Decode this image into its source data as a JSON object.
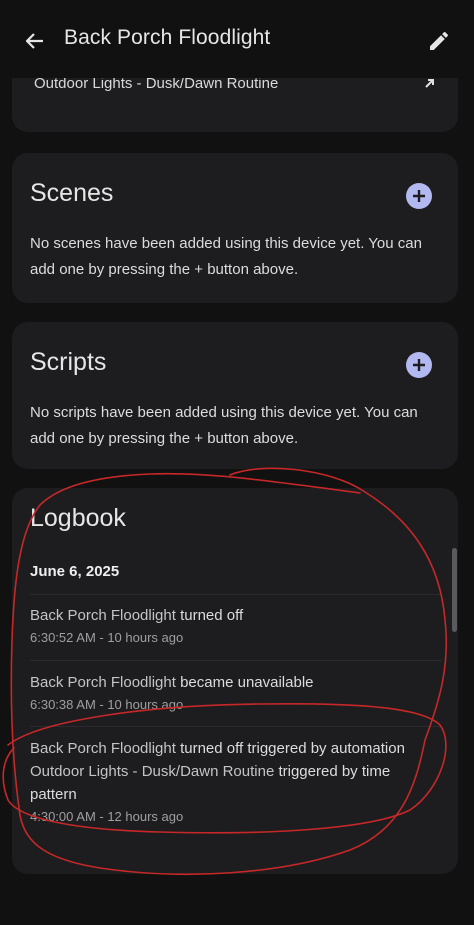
{
  "header": {
    "title": "Back Porch Floodlight",
    "back_icon": "arrow-left-icon",
    "edit_icon": "pencil-icon"
  },
  "automations": {
    "item_label": "Outdoor Lights - Dusk/Dawn Routine",
    "item_icon": "arrow-up-right-icon"
  },
  "scenes": {
    "title": "Scenes",
    "description": "No scenes have been added using this device yet. You can add one by pressing the + button above."
  },
  "scripts": {
    "title": "Scripts",
    "description": "No scripts have been added using this device yet. You can add one by pressing the + button above."
  },
  "logbook": {
    "title": "Logbook",
    "date": "June 6, 2025",
    "entries": [
      {
        "entity": "Back Porch Floodlight",
        "message": " turned off",
        "time": "6:30:52 AM - 10 hours ago"
      },
      {
        "entity": "Back Porch Floodlight",
        "message": " became unavailable",
        "time": "6:30:38 AM - 10 hours ago"
      },
      {
        "entity": "Back Porch Floodlight",
        "message": " turned off triggered by automation ",
        "automation": "Outdoor Lights - Dusk/Dawn Routine",
        "trigger": " triggered by time pattern",
        "time": "4:30:00 AM - 12 hours ago"
      }
    ]
  },
  "colors": {
    "background": "#111111",
    "card": "#1d1d20",
    "accent": "#b2b8f0",
    "annotation": "#c62828"
  }
}
